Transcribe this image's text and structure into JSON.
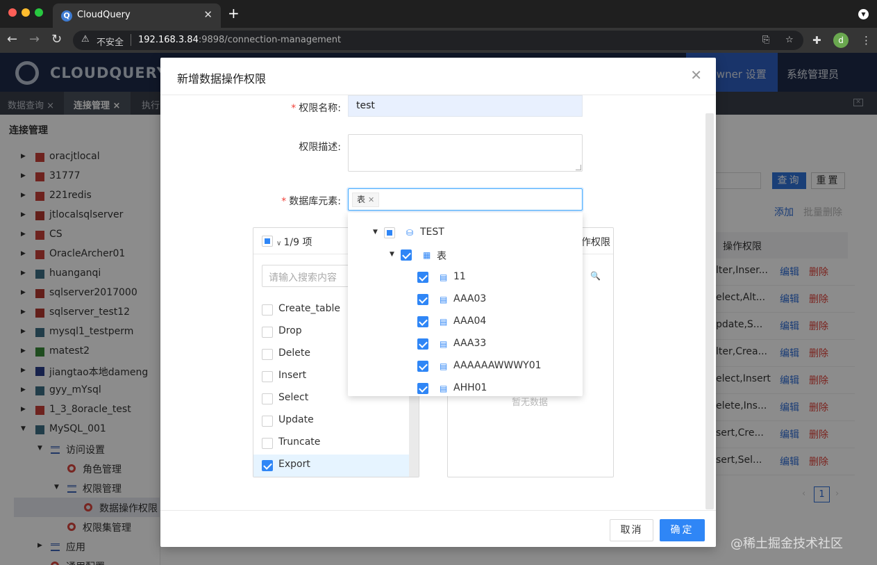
{
  "browser": {
    "tab_title": "CloudQuery",
    "favicon_letter": "Q",
    "insecure_label": "不安全",
    "url_host": "192.168.3.84",
    "url_rest": ":9898/connection-management",
    "profile_initial": "d"
  },
  "app": {
    "logo_text": "CLOUDQUERY",
    "nav_owner": "Owner 设置",
    "nav_admin": "系统管理员",
    "tabs": [
      {
        "label": "数据查询 ×"
      },
      {
        "label": "连接管理 ×"
      },
      {
        "label": "执行"
      }
    ],
    "sidebar_title": "连接管理",
    "tree": [
      {
        "label": "oracjtlocal",
        "color": "#c9403a"
      },
      {
        "label": "31777",
        "color": "#c9403a"
      },
      {
        "label": "221redis",
        "color": "#c9403a"
      },
      {
        "label": "jtlocalsqlserver",
        "color": "#b53a30"
      },
      {
        "label": "CS",
        "color": "#c9403a"
      },
      {
        "label": "OracleArcher01",
        "color": "#c9403a"
      },
      {
        "label": "huanganqi",
        "color": "#3d6f86"
      },
      {
        "label": "sqlserver2017000",
        "color": "#b53a30"
      },
      {
        "label": "sqlserver_test12",
        "color": "#b53a30"
      },
      {
        "label": "mysql1_testperm",
        "color": "#3d6f86"
      },
      {
        "label": "matest2",
        "color": "#3a8a3a"
      },
      {
        "label": "jiangtao本地dameng",
        "color": "#2b3f8a"
      },
      {
        "label": "gyy_mYsql",
        "color": "#3d6f86"
      },
      {
        "label": "1_3_8oracle_test",
        "color": "#c9403a"
      },
      {
        "label": "MySQL_001",
        "color": "#3d6f86"
      }
    ],
    "subtree": [
      {
        "label": "访问设置"
      },
      {
        "label": "角色管理"
      },
      {
        "label": "权限管理"
      },
      {
        "label": "数据操作权限"
      },
      {
        "label": "权限集管理"
      },
      {
        "label": "应用"
      },
      {
        "label": "通用配置"
      }
    ],
    "btn_query": "查询",
    "btn_reset": "重置",
    "link_add": "添加",
    "link_batch_delete": "批量删除",
    "table_header": "操作权限",
    "rows": [
      {
        "perm": "lter,Inser..."
      },
      {
        "perm": "elect,Alt..."
      },
      {
        "perm": "pdate,S..."
      },
      {
        "perm": "lter,Crea..."
      },
      {
        "perm": "elect,Insert"
      },
      {
        "perm": "elete,Ins..."
      },
      {
        "perm": "sert,Cre..."
      },
      {
        "perm": "sert,Sel..."
      }
    ],
    "row_edit": "编辑",
    "row_delete": "删除",
    "page_current": "1",
    "watermark": "@稀土掘金技术社区"
  },
  "modal": {
    "title": "新增数据操作权限",
    "label_name": "权限名称:",
    "value_name": "test",
    "label_desc": "权限描述:",
    "value_desc": "",
    "label_elements": "数据库元素:",
    "tag": "表",
    "left_count": "1/9 项",
    "left_search_placeholder": "请输入搜索内容",
    "operations": [
      {
        "label": "Create_table",
        "checked": false
      },
      {
        "label": "Drop",
        "checked": false
      },
      {
        "label": "Delete",
        "checked": false
      },
      {
        "label": "Insert",
        "checked": false
      },
      {
        "label": "Select",
        "checked": false
      },
      {
        "label": "Update",
        "checked": false
      },
      {
        "label": "Truncate",
        "checked": false
      },
      {
        "label": "Export",
        "checked": true
      }
    ],
    "right_title": "作权限",
    "right_empty": "暂无数据",
    "cancel": "取消",
    "ok": "确定",
    "dropdown": [
      {
        "label": "TEST",
        "level": 0,
        "icon": "database-icon",
        "state": "half"
      },
      {
        "label": "表",
        "level": 1,
        "icon": "table-icon",
        "state": "on"
      },
      {
        "label": "11",
        "level": 2,
        "icon": "file-icon",
        "state": "on"
      },
      {
        "label": "AAA03",
        "level": 2,
        "icon": "file-icon",
        "state": "on"
      },
      {
        "label": "AAA04",
        "level": 2,
        "icon": "file-icon",
        "state": "on"
      },
      {
        "label": "AAA33",
        "level": 2,
        "icon": "file-icon",
        "state": "on"
      },
      {
        "label": "AAAAAAWWWY01",
        "level": 2,
        "icon": "file-icon",
        "state": "on"
      },
      {
        "label": "AHH01",
        "level": 2,
        "icon": "file-icon",
        "state": "on"
      }
    ]
  }
}
